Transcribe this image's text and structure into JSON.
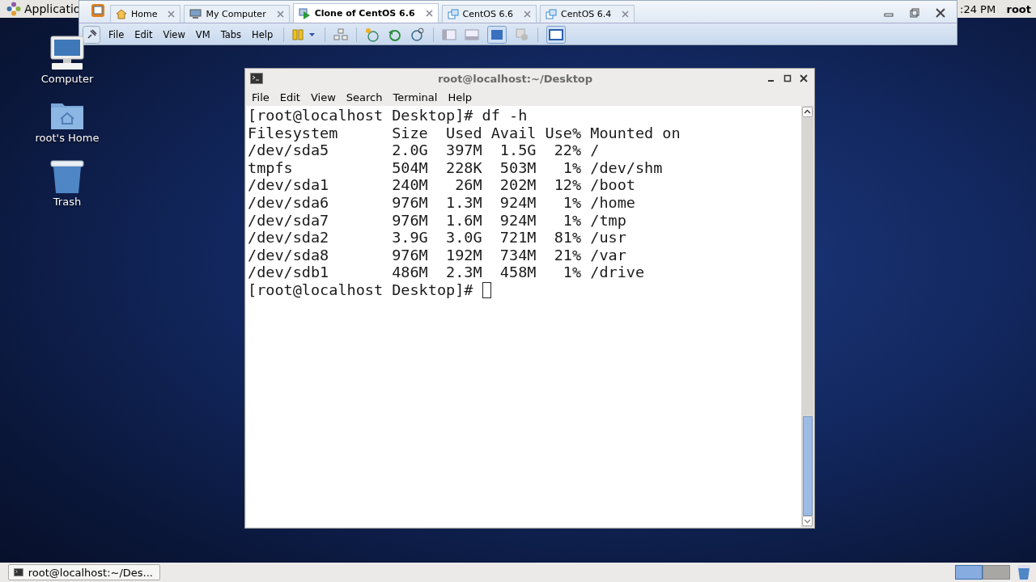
{
  "top_panel": {
    "menu": "Applicatio",
    "clock": ":24 PM",
    "user": "root"
  },
  "vmware": {
    "tabs": [
      {
        "label": "Home",
        "kind": "home",
        "selected": false
      },
      {
        "label": "My Computer",
        "kind": "computer",
        "selected": false
      },
      {
        "label": "Clone of CentOS 6.6",
        "kind": "running",
        "selected": true
      },
      {
        "label": "CentOS 6.6",
        "kind": "vm",
        "selected": false
      },
      {
        "label": "CentOS 6.4",
        "kind": "vm",
        "selected": false
      }
    ],
    "menu": [
      "File",
      "Edit",
      "View",
      "VM",
      "Tabs",
      "Help"
    ]
  },
  "desktop_icons": [
    {
      "label": "Computer",
      "kind": "computer"
    },
    {
      "label": "root's Home",
      "kind": "home"
    },
    {
      "label": "Trash",
      "kind": "trash"
    }
  ],
  "terminal": {
    "title": "root@localhost:~/Desktop",
    "menu": [
      "File",
      "Edit",
      "View",
      "Search",
      "Terminal",
      "Help"
    ],
    "lines": [
      "[root@localhost Desktop]# df -h",
      "Filesystem      Size  Used Avail Use% Mounted on",
      "/dev/sda5       2.0G  397M  1.5G  22% /",
      "tmpfs           504M  228K  503M   1% /dev/shm",
      "/dev/sda1       240M   26M  202M  12% /boot",
      "/dev/sda6       976M  1.3M  924M   1% /home",
      "/dev/sda7       976M  1.6M  924M   1% /tmp",
      "/dev/sda2       3.9G  3.0G  721M  81% /usr",
      "/dev/sda8       976M  192M  734M  21% /var",
      "/dev/sdb1       486M  2.3M  458M   1% /drive"
    ],
    "prompt": {
      "text": "[root@localhost Desktop]# ",
      "cursor": true
    }
  },
  "taskbar": {
    "items": [
      {
        "label": "root@localhost:~/Des...",
        "selected": false
      }
    ],
    "workspaces": [
      {
        "selected": true
      },
      {
        "selected": false
      }
    ]
  }
}
